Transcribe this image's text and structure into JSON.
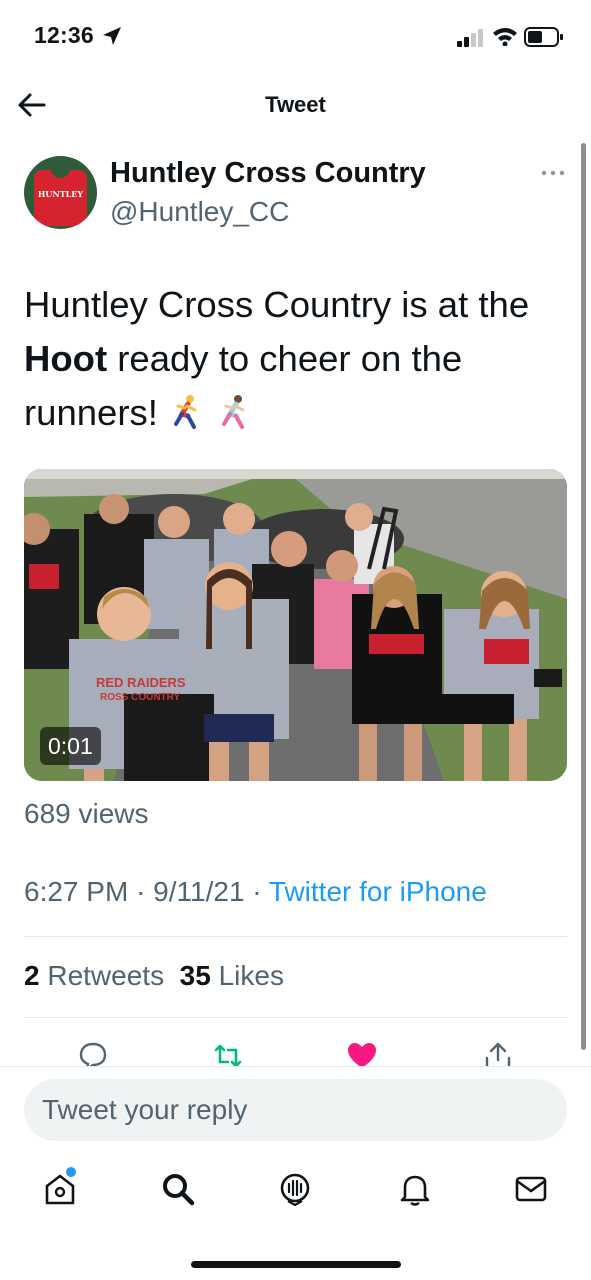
{
  "status_bar": {
    "time": "12:36"
  },
  "nav": {
    "title": "Tweet"
  },
  "tweet": {
    "author_name": "Huntley Cross Country",
    "author_handle": "@Huntley_CC",
    "avatar_text": "HUNTLEY",
    "text_part1": "Huntley Cross Country is at the ",
    "text_bold": "Hoot",
    "text_part2": " ready to cheer on the runners! ",
    "media": {
      "duration": "0:01",
      "shirt_text_1": "RED RAIDERS",
      "shirt_text_2": "ROSS COUNTRY"
    },
    "views": "689 views",
    "time": "6:27 PM",
    "date": "9/11/21",
    "separator": "·",
    "source": "Twitter for iPhone",
    "retweets_count": "2",
    "retweets_label": "Retweets",
    "likes_count": "35",
    "likes_label": "Likes"
  },
  "reply": {
    "placeholder": "Tweet your reply"
  },
  "colors": {
    "accent": "#1d9bf0",
    "retweet": "#00ba7c",
    "like": "#f91880",
    "muted": "#536471"
  },
  "tabbar": {
    "items": [
      "home-icon",
      "search-icon",
      "spaces-icon",
      "notifications-icon",
      "messages-icon"
    ]
  }
}
